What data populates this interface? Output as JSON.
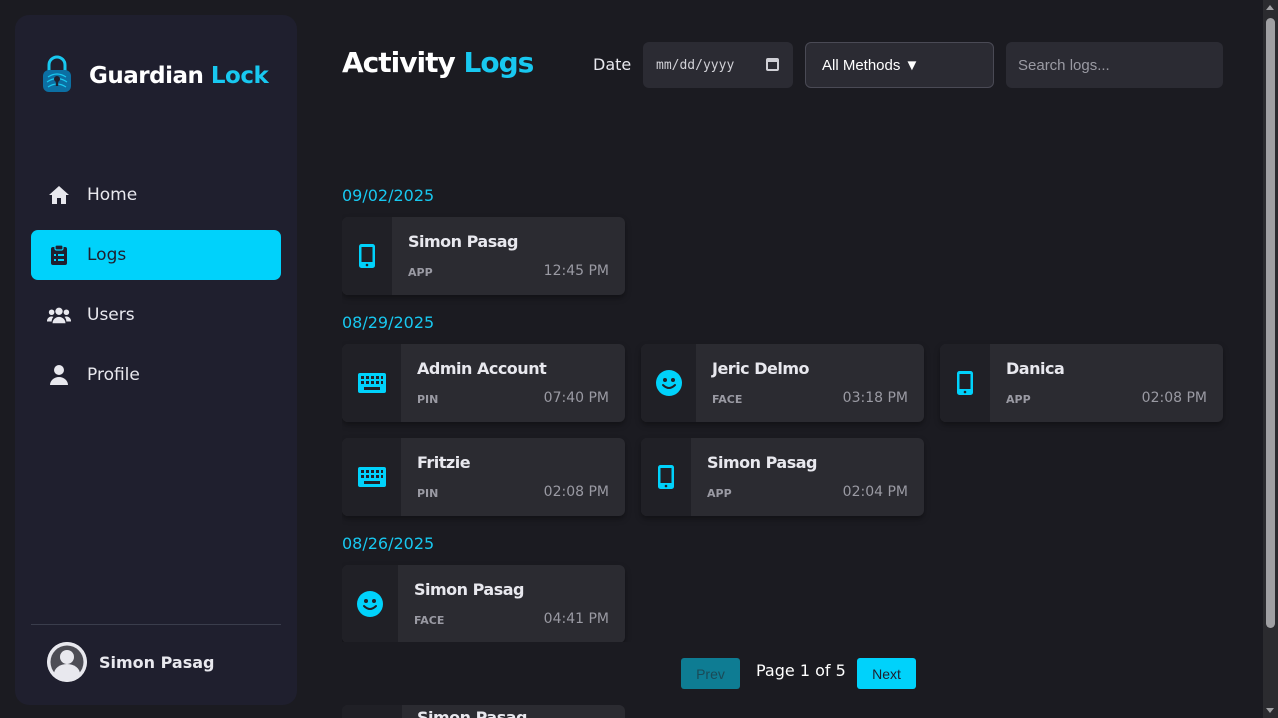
{
  "brand": {
    "title_part1": "Guardian",
    "title_part2": "Lock"
  },
  "nav": [
    {
      "label": "Home",
      "icon": "home-icon"
    },
    {
      "label": "Logs",
      "icon": "clipboard-icon",
      "active": true
    },
    {
      "label": "Users",
      "icon": "users-icon"
    },
    {
      "label": "Profile",
      "icon": "user-icon"
    }
  ],
  "user": {
    "name": "Simon Pasag"
  },
  "header": {
    "title_part1": "Activity",
    "title_part2": "Logs",
    "date_label": "Date",
    "date_placeholder": "mm/dd/yyyy",
    "method_value": "All Methods ▼",
    "search_placeholder": "Search logs..."
  },
  "groups": [
    {
      "date": "09/02/2025",
      "logs": [
        {
          "name": "Simon Pasag",
          "method": "APP",
          "time": "12:45 PM",
          "icon": "phone-icon"
        }
      ]
    },
    {
      "date": "08/29/2025",
      "logs": [
        {
          "name": "Admin Account",
          "method": "PIN",
          "time": "07:40 PM",
          "icon": "keyboard-icon"
        },
        {
          "name": "Jeric Delmo",
          "method": "FACE",
          "time": "03:18 PM",
          "icon": "face-icon"
        },
        {
          "name": "Danica",
          "method": "APP",
          "time": "02:08 PM",
          "icon": "phone-icon"
        },
        {
          "name": "Fritzie",
          "method": "PIN",
          "time": "02:08 PM",
          "icon": "keyboard-icon"
        },
        {
          "name": "Simon Pasag",
          "method": "APP",
          "time": "02:04 PM",
          "icon": "phone-icon"
        }
      ]
    },
    {
      "date": "08/26/2025",
      "logs": [
        {
          "name": "Simon Pasag",
          "method": "FACE",
          "time": "04:41 PM",
          "icon": "face-icon"
        }
      ]
    }
  ],
  "peek": {
    "name": "Simon Pasag"
  },
  "pagination": {
    "prev": "Prev",
    "next": "Next",
    "indicator": "Page 1 of 5"
  },
  "colors": {
    "accent": "#00d2fb",
    "background": "#1b1b21",
    "sidebar": "#1f1f2e",
    "card": "#2b2b31"
  }
}
